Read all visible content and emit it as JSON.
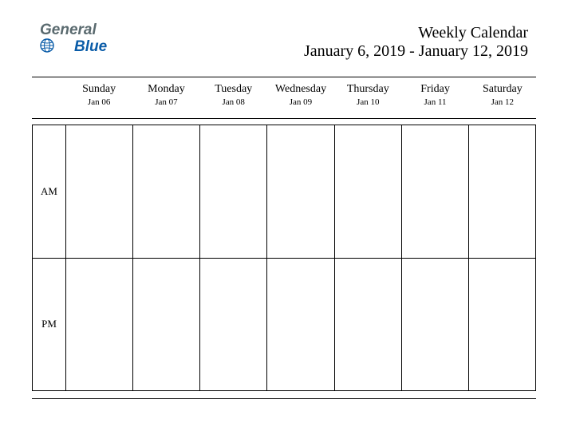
{
  "logo": {
    "line1": "General",
    "line2": "Blue"
  },
  "title": {
    "line1": "Weekly Calendar",
    "line2": "January 6, 2019 - January 12, 2019"
  },
  "days": [
    {
      "name": "Sunday",
      "date": "Jan 06"
    },
    {
      "name": "Monday",
      "date": "Jan 07"
    },
    {
      "name": "Tuesday",
      "date": "Jan 08"
    },
    {
      "name": "Wednesday",
      "date": "Jan 09"
    },
    {
      "name": "Thursday",
      "date": "Jan 10"
    },
    {
      "name": "Friday",
      "date": "Jan 11"
    },
    {
      "name": "Saturday",
      "date": "Jan 12"
    }
  ],
  "rows": {
    "am": "AM",
    "pm": "PM"
  }
}
